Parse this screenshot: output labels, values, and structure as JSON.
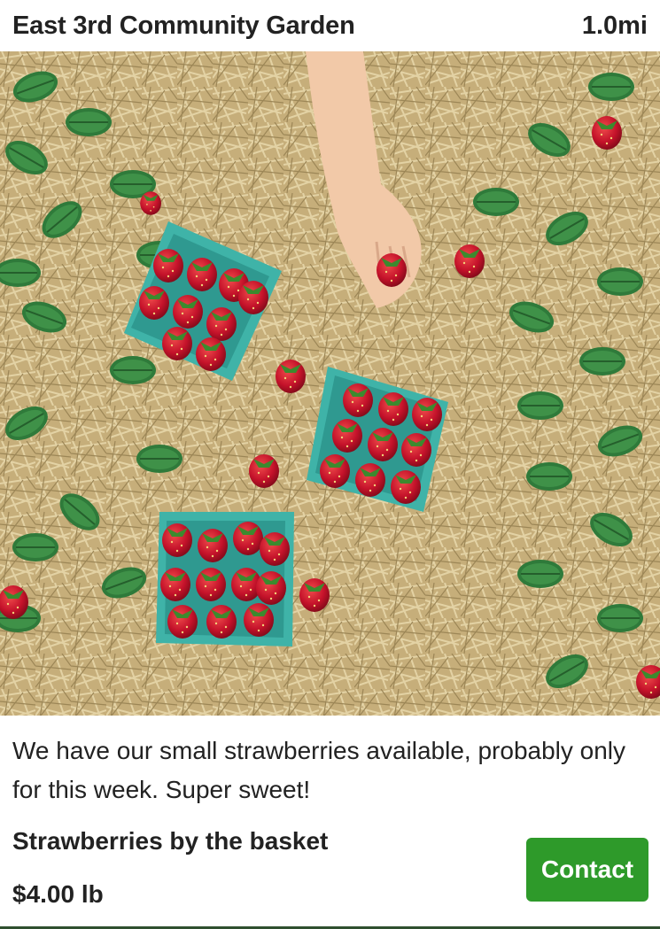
{
  "listing": {
    "title": "East 3rd Community Garden",
    "distance": "1.0mi",
    "description": "We have our small strawberries available, probably only for this week. Super sweet!",
    "product_name": "Strawberries by the basket",
    "price": "$4.00 lb",
    "contact_label": "Contact"
  },
  "colors": {
    "contact_button": "#2e9a2a",
    "straw": "#c9b27e",
    "leaf": "#2f7a3a",
    "berry": "#c4122a",
    "basket": "#3fb3a8"
  }
}
